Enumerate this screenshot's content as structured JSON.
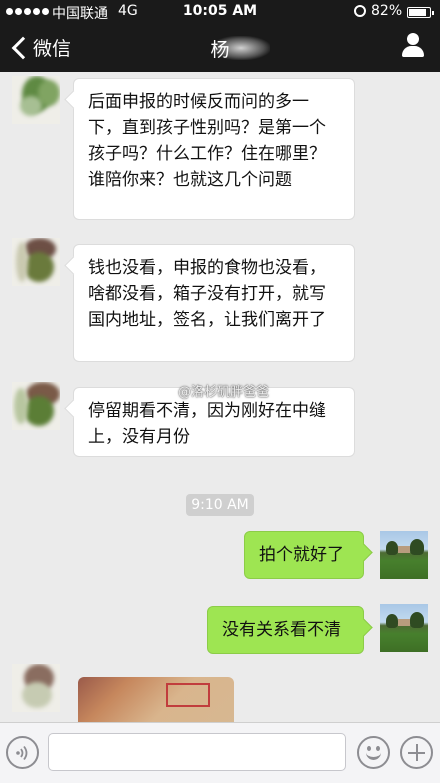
{
  "status_bar": {
    "carrier": "中国联通",
    "network": "4G",
    "time": "10:05 AM",
    "battery": "82%"
  },
  "nav": {
    "back_label": "微信",
    "title": "杨"
  },
  "messages": [
    {
      "side": "left",
      "text": "后面申报的时候反而问的多一下，直到孩子性别吗？是第一个孩子吗？什么工作？住在哪里？谁陪你来？也就这几个问题"
    },
    {
      "side": "left",
      "text": "钱也没看，申报的食物也没看，啥都没看，箱子没有打开，就写国内地址，签名，让我们离开了"
    },
    {
      "side": "left",
      "text": "停留期看不清，因为刚好在中缝上，没有月份"
    },
    {
      "side": "right",
      "text": "拍个就好了"
    },
    {
      "side": "right",
      "text": "没有关系看不清"
    }
  ],
  "timestamp": "9:10 AM",
  "watermark": "@洛杉矶胖爸爸",
  "icons": {
    "back": "chevron-left-icon",
    "contact": "person-icon",
    "voice": "voice-icon",
    "emoji": "emoji-icon",
    "more": "plus-icon"
  },
  "colors": {
    "header": "#1a1a1a",
    "chat_background": "#ebebeb",
    "sent_bubble": "#9ee552",
    "received_bubble": "#ffffff"
  }
}
